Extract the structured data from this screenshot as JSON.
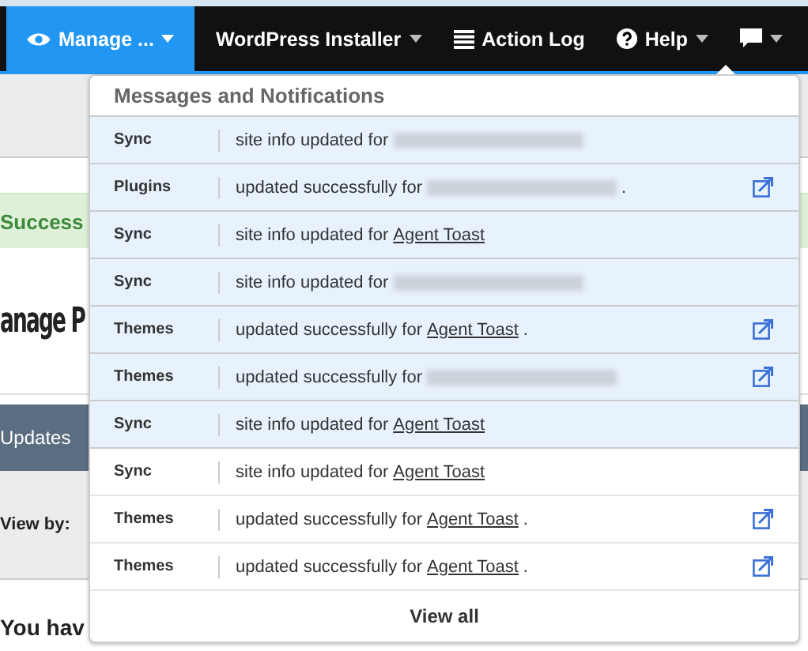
{
  "nav": [
    {
      "label": "Manage ...",
      "kind": "eye",
      "caret": true,
      "selected": true
    },
    {
      "label": "WordPress Installer",
      "kind": "plain",
      "caret": true,
      "selected": false
    },
    {
      "label": "Action Log",
      "kind": "list",
      "caret": false,
      "selected": false
    },
    {
      "label": "Help",
      "kind": "help",
      "caret": true,
      "selected": false
    },
    {
      "kind": "chat",
      "caret": true,
      "selected": false
    }
  ],
  "page": {
    "alert": "Success",
    "heading": "anage P",
    "tab": "Updates",
    "filter_label": "View by:",
    "notice": "You hav"
  },
  "notifications": {
    "title": "Messages and Notifications",
    "footer": "View all",
    "items": [
      {
        "category": "Sync",
        "text": "site info updated for",
        "site_blurred": true,
        "unread": true,
        "external": false
      },
      {
        "category": "Plugins",
        "text": "updated successfully for",
        "site_blurred": true,
        "suffix": ".",
        "unread": true,
        "external": true
      },
      {
        "category": "Sync",
        "text": "site info updated for",
        "site": "Agent Toast",
        "unread": true,
        "external": false
      },
      {
        "category": "Sync",
        "text": "site info updated for",
        "site_blurred": true,
        "unread": true,
        "external": false
      },
      {
        "category": "Themes",
        "text": "updated successfully for",
        "site": "Agent Toast",
        "suffix": ".",
        "unread": true,
        "external": true
      },
      {
        "category": "Themes",
        "text": "updated successfully for",
        "site_blurred": true,
        "unread": true,
        "external": true
      },
      {
        "category": "Sync",
        "text": "site info updated for",
        "site": "Agent Toast",
        "unread": true,
        "external": false
      },
      {
        "category": "Sync",
        "text": "site info updated for",
        "site": "Agent Toast",
        "unread": false,
        "external": false
      },
      {
        "category": "Themes",
        "text": "updated successfully for",
        "site": "Agent Toast",
        "suffix": ".",
        "unread": false,
        "external": true
      },
      {
        "category": "Themes",
        "text": "updated successfully for",
        "site": "Agent Toast",
        "suffix": ".",
        "unread": false,
        "external": true
      }
    ]
  }
}
